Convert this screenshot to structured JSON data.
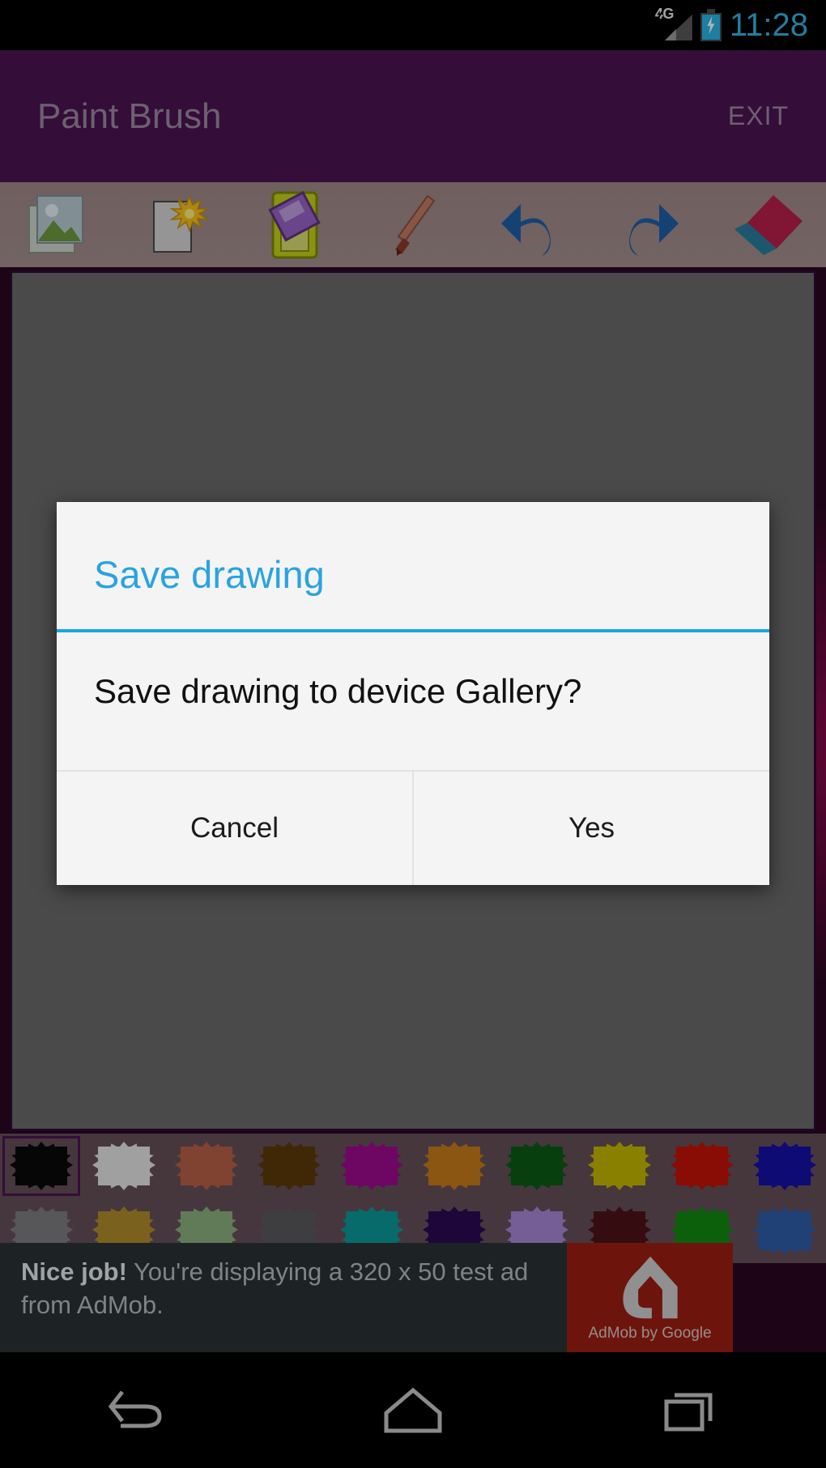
{
  "status_bar": {
    "network_label": "4G",
    "clock": "11:28",
    "signal_icon": "signal-bars-icon",
    "battery_icon": "battery-charging-icon"
  },
  "app_bar": {
    "title": "Paint Brush",
    "exit_label": "EXIT"
  },
  "toolbar": {
    "items": [
      {
        "name": "gallery-icon",
        "label": "Gallery"
      },
      {
        "name": "new-page-icon",
        "label": "New"
      },
      {
        "name": "save-icon",
        "label": "Save"
      },
      {
        "name": "brush-icon",
        "label": "Brush"
      },
      {
        "name": "undo-icon",
        "label": "Undo"
      },
      {
        "name": "redo-icon",
        "label": "Redo"
      },
      {
        "name": "eraser-icon",
        "label": "Eraser"
      }
    ]
  },
  "canvas": {
    "background_color": "#6b6b6b",
    "border_color": "#2b0a35"
  },
  "dialog": {
    "title": "Save drawing",
    "message": "Save drawing to device Gallery?",
    "title_color": "#2aa3e0",
    "accent_rule_color": "#17a5e2",
    "buttons": [
      {
        "label": "Cancel",
        "name": "cancel-button"
      },
      {
        "label": "Yes",
        "name": "yes-button"
      }
    ]
  },
  "palette": {
    "selected_index": 0,
    "row1": [
      {
        "name": "color-black",
        "hex": "#0a0a0a"
      },
      {
        "name": "color-white",
        "hex": "#e6e6e6"
      },
      {
        "name": "color-salmon",
        "hex": "#b85f47"
      },
      {
        "name": "color-brown",
        "hex": "#5c3a0a"
      },
      {
        "name": "color-magenta",
        "hex": "#9c0b8e"
      },
      {
        "name": "color-orange",
        "hex": "#c67c1a"
      },
      {
        "name": "color-dark-green",
        "hex": "#0b5b15"
      },
      {
        "name": "color-olive",
        "hex": "#c6b800"
      },
      {
        "name": "color-red",
        "hex": "#c41208"
      },
      {
        "name": "color-blue",
        "hex": "#1510a8"
      }
    ],
    "row2": [
      {
        "name": "color-gray",
        "hex": "#7d7d80"
      },
      {
        "name": "color-dark-khaki",
        "hex": "#b08c2c"
      },
      {
        "name": "color-sage-green",
        "hex": "#8bb07e"
      },
      {
        "name": "color-dim-gray",
        "hex": "#5a5a5c"
      },
      {
        "name": "color-teal",
        "hex": "#0c9a9a"
      },
      {
        "name": "color-indigo",
        "hex": "#2b0a55"
      },
      {
        "name": "color-lavender",
        "hex": "#a887d6"
      },
      {
        "name": "color-maroon",
        "hex": "#4d1418"
      },
      {
        "name": "color-green",
        "hex": "#128a12"
      },
      {
        "name": "color-steel-blue",
        "hex": "#2d5ea8"
      }
    ]
  },
  "ad": {
    "headline": "Nice job!",
    "body": " You're displaying a 320 x 50 test ad from AdMob.",
    "logo_label": "AdMob by Google",
    "logo_background": "#9d1f13"
  },
  "nav_bar": {
    "back": "back-icon",
    "home": "home-icon",
    "recents": "recents-icon"
  }
}
